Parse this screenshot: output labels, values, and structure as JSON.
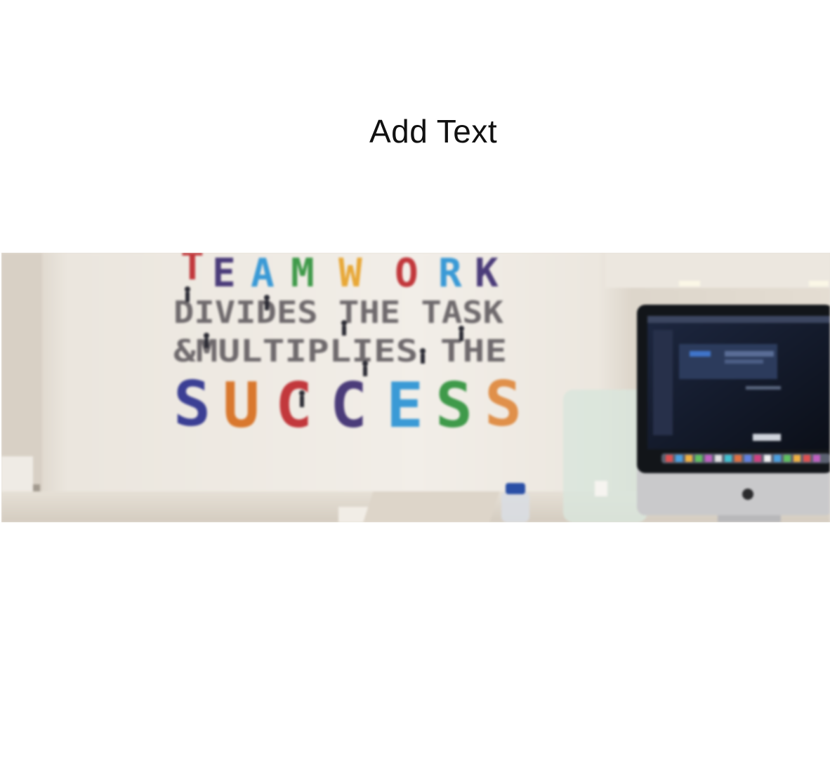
{
  "canvas": {
    "add_text_label": "Add Text"
  },
  "photo": {
    "wall_lines": [
      "TEAMWORK",
      "DIVIDES THE TASK",
      "& MULTIPLIES THE",
      "SUCCESS"
    ],
    "success_letter_colors": [
      "#3b3f94",
      "#d9782e",
      "#c2383c",
      "#4b3c7a",
      "#3a9ad6",
      "#3f9a4a",
      "#e0904a"
    ]
  }
}
